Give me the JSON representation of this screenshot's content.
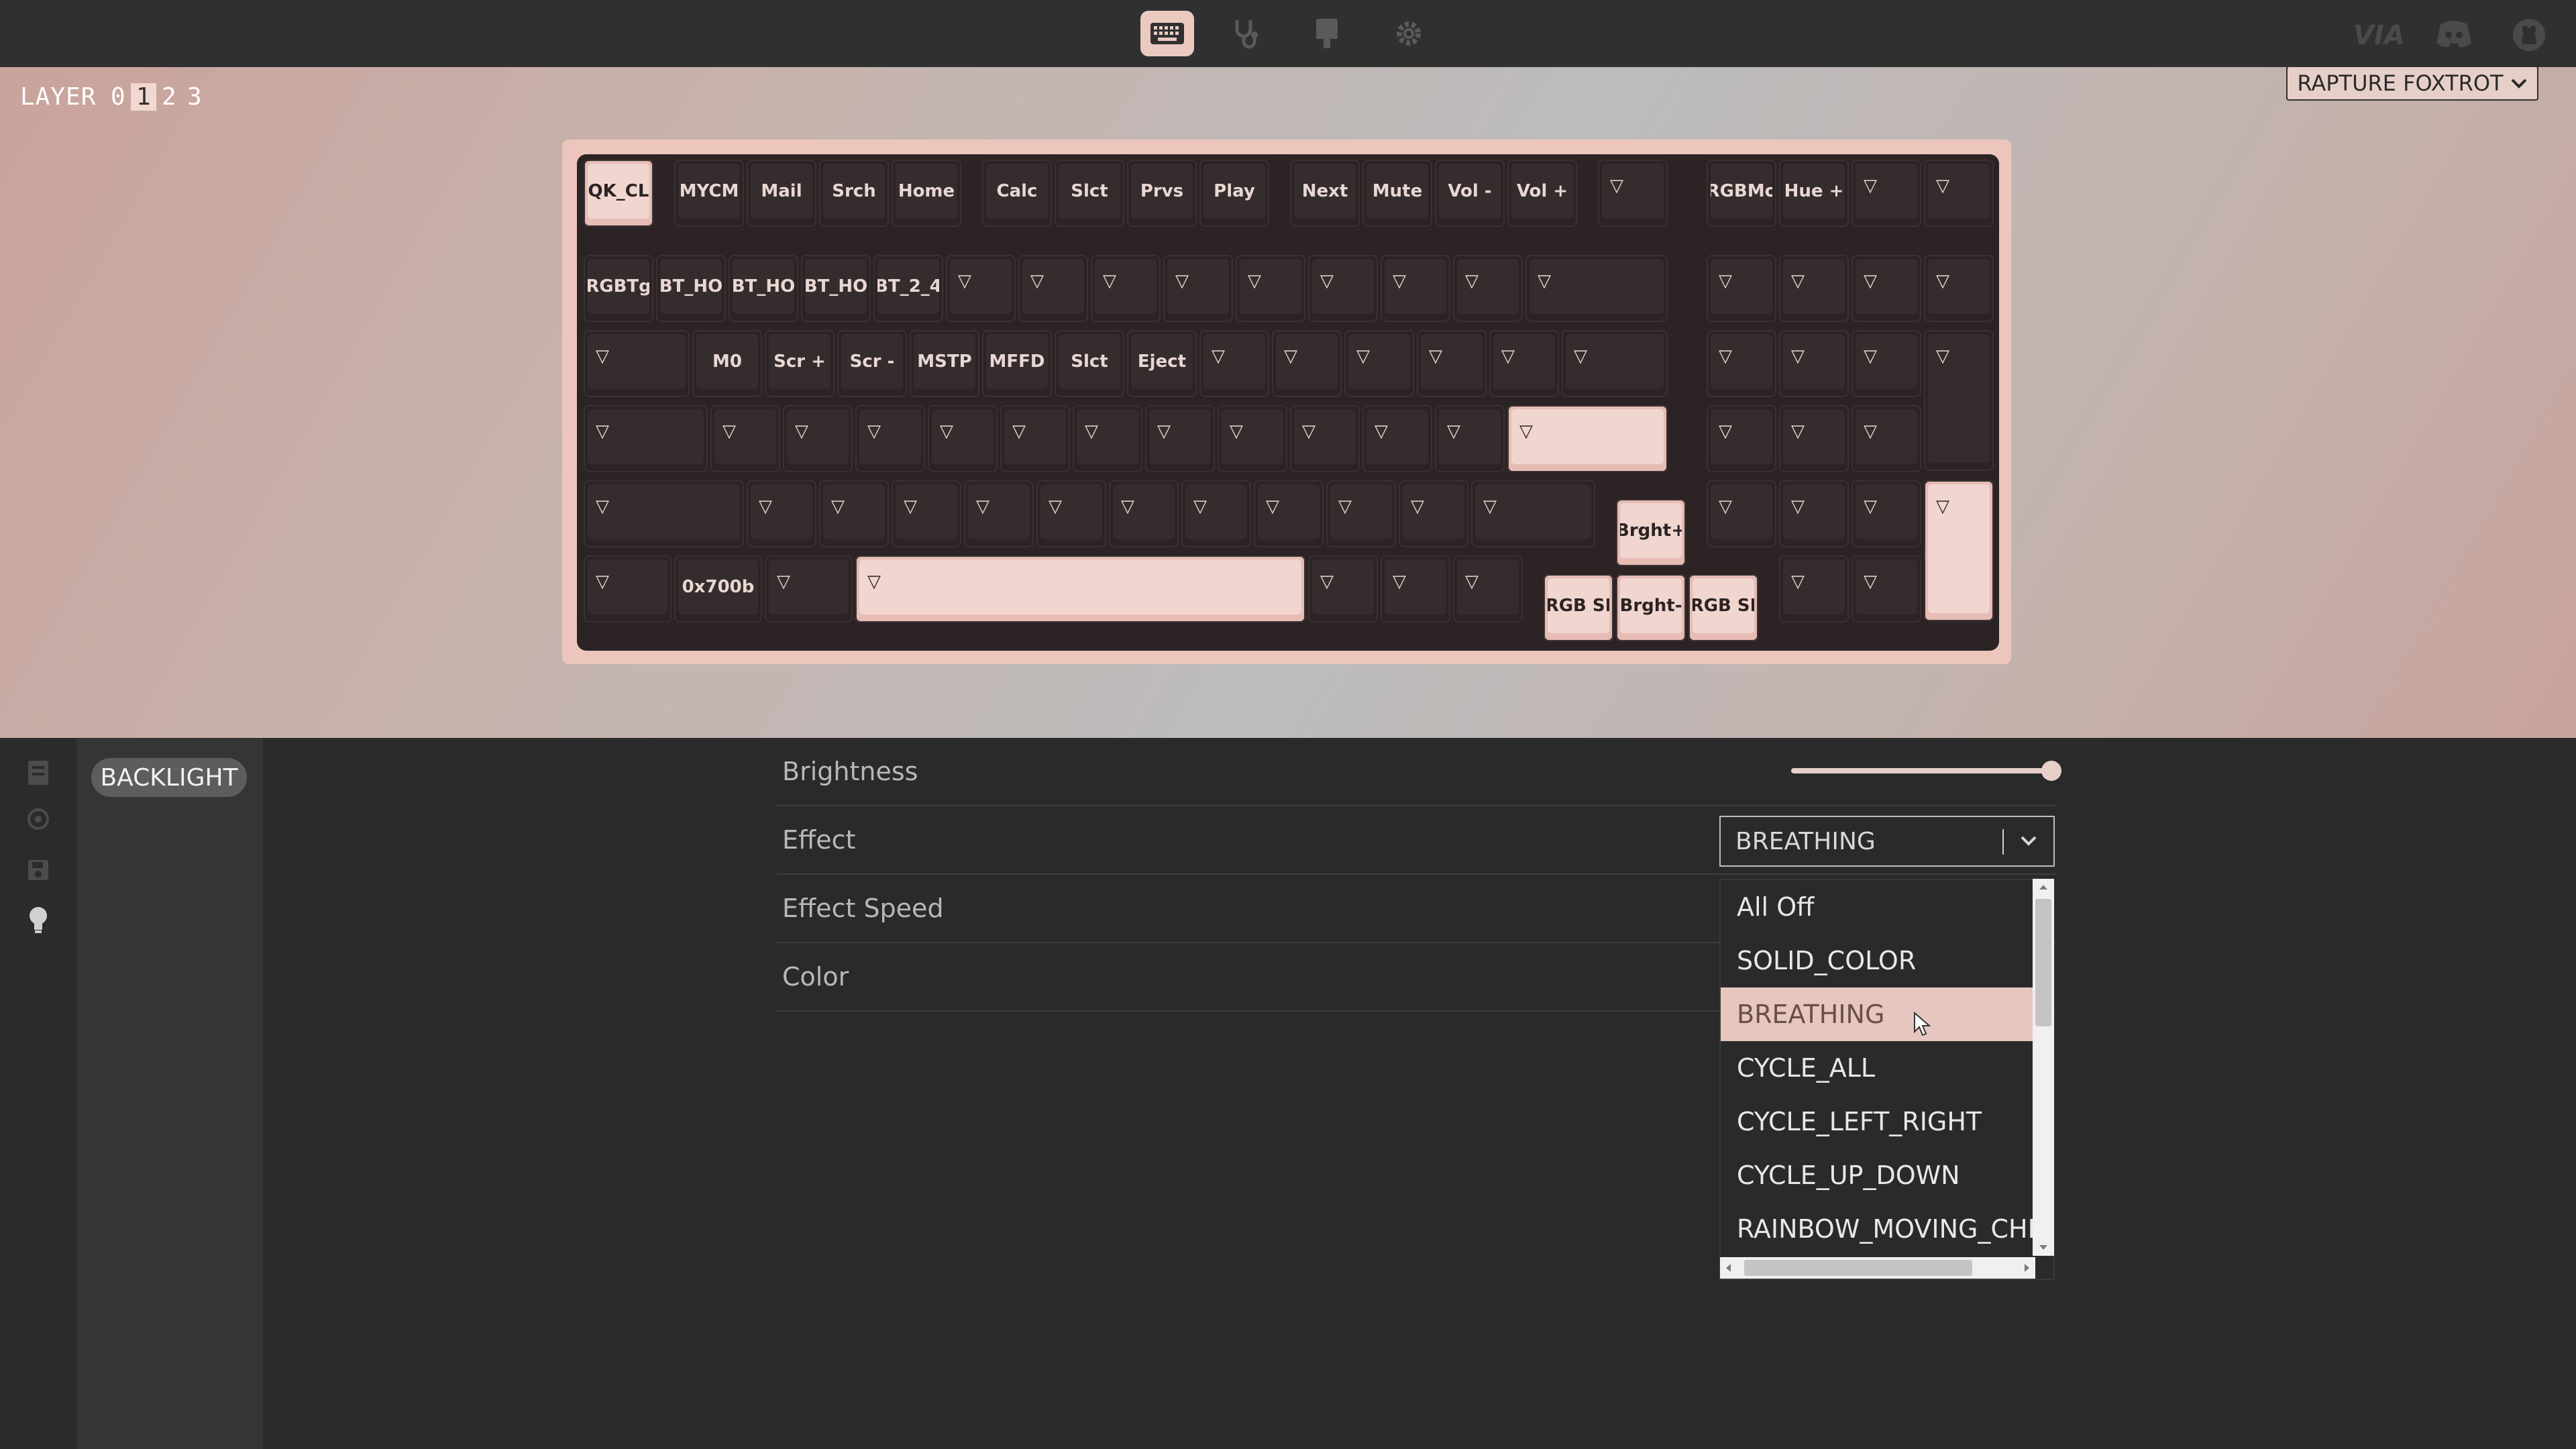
{
  "nav": {
    "icons": [
      "keyboard-icon",
      "stethoscope-icon",
      "paintbrush-icon",
      "gear-icon"
    ],
    "right_logos": [
      "via-logo",
      "discord-icon",
      "github-icon"
    ]
  },
  "layer": {
    "label": "LAYER",
    "items": [
      "0",
      "1",
      "2",
      "3"
    ],
    "active": "1"
  },
  "device": {
    "name": "RAPTURE FOXTROT"
  },
  "keyboard": {
    "row0": [
      "QK_CL",
      "MYCM",
      "Mail",
      "Srch",
      "Home",
      "Calc",
      "Slct",
      "Prvs",
      "Play",
      "Next",
      "Mute",
      "Vol -",
      "Vol +",
      "",
      "RGBMo",
      "Hue +",
      "",
      ""
    ],
    "row1": [
      "RGBTg",
      "BT_HO",
      "BT_HO",
      "BT_HO",
      "BT_2_4",
      "",
      "",
      "",
      "",
      "",
      "",
      "",
      "",
      "",
      "",
      "",
      "",
      ""
    ],
    "row2": [
      "",
      "M0",
      "Scr +",
      "Scr -",
      "MSTP",
      "MFFD",
      "Slct",
      "Eject",
      "",
      "",
      "",
      "",
      "",
      "",
      "",
      "",
      "",
      ""
    ],
    "row3": [
      "",
      "",
      "",
      "",
      "",
      "",
      "",
      "",
      "",
      "",
      "",
      "",
      "",
      "",
      "",
      "",
      ""
    ],
    "row4": [
      "",
      "",
      "",
      "",
      "",
      "",
      "",
      "",
      "",
      "",
      "",
      "",
      "",
      "",
      "",
      "",
      "Brght+"
    ],
    "row5": [
      "",
      "0x700b",
      "",
      "",
      "",
      "",
      "",
      "RGB SI",
      "Brght-",
      "RGB SI",
      "",
      ""
    ]
  },
  "bottom": {
    "left_icons": [
      "layers-icon",
      "target-icon",
      "save-icon",
      "lightbulb-icon"
    ],
    "submenu": {
      "item": "BACKLIGHT"
    },
    "settings": {
      "brightness_label": "Brightness",
      "effect_label": "Effect",
      "effect_speed_label": "Effect Speed",
      "color_label": "Color",
      "brightness_value": 1.0,
      "effect_value": "BREATHING"
    },
    "effect_options": [
      "All Off",
      "SOLID_COLOR",
      "BREATHING",
      "CYCLE_ALL",
      "CYCLE_LEFT_RIGHT",
      "CYCLE_UP_DOWN",
      "RAINBOW_MOVING_CHEVRON"
    ],
    "selected_option": "BREATHING"
  },
  "colors": {
    "accent": "#e6c7bf",
    "topbar": "#303030",
    "plate": "#2b2324"
  }
}
